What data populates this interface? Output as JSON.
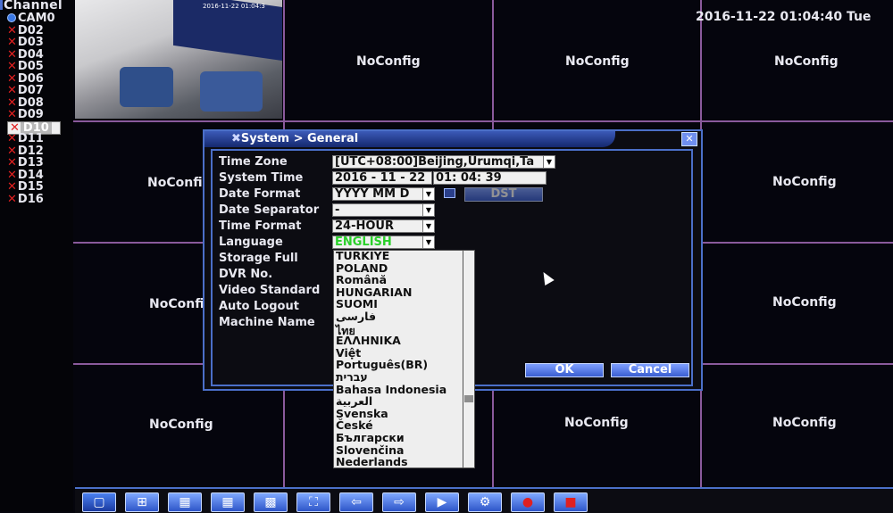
{
  "channel_panel": {
    "header": "Channel",
    "channels": [
      {
        "label": "CAM0",
        "status": "camera"
      },
      {
        "label": "D02",
        "status": "x"
      },
      {
        "label": "D03",
        "status": "x"
      },
      {
        "label": "D04",
        "status": "x"
      },
      {
        "label": "D05",
        "status": "x"
      },
      {
        "label": "D06",
        "status": "x"
      },
      {
        "label": "D07",
        "status": "x"
      },
      {
        "label": "D08",
        "status": "x"
      },
      {
        "label": "D09",
        "status": "x"
      },
      {
        "label": "D10",
        "status": "x",
        "selected": true
      },
      {
        "label": "D11",
        "status": "x"
      },
      {
        "label": "D12",
        "status": "x"
      },
      {
        "label": "D13",
        "status": "x"
      },
      {
        "label": "D14",
        "status": "x"
      },
      {
        "label": "D15",
        "status": "x"
      },
      {
        "label": "D16",
        "status": "x"
      }
    ]
  },
  "datetime": "2016-11-22 01:04:40 Tue",
  "camera_stamp": "2016-11-22 01:04:3",
  "grid": {
    "noconfig_label": "NoConfig",
    "truncated_label": "NoConfi"
  },
  "dialog": {
    "title": "System > General",
    "close_icon": "close-icon",
    "fields": {
      "time_zone": {
        "label": "Time Zone",
        "value": "[UTC+08:00]Beijing,Urumqi,Ta"
      },
      "system_time": {
        "label": "System Time",
        "date": "2016 - 11 - 22",
        "time": "01: 04: 39"
      },
      "date_format": {
        "label": "Date Format",
        "value": "YYYY MM D"
      },
      "date_separator": {
        "label": "Date Separator",
        "value": "-"
      },
      "time_format": {
        "label": "Time Format",
        "value": "24-HOUR"
      },
      "language": {
        "label": "Language",
        "value": "ENGLISH"
      },
      "storage_full": {
        "label": "Storage Full"
      },
      "dvr_no": {
        "label": "DVR No."
      },
      "video_standard": {
        "label": "Video Standard"
      },
      "auto_logout": {
        "label": "Auto Logout"
      },
      "machine_name": {
        "label": "Machine Name"
      }
    },
    "dst_button": "DST",
    "ok_button": "OK",
    "cancel_button": "Cancel"
  },
  "language_options": [
    "TÜRKIYE",
    "POLAND",
    "Română",
    "HUNGARIAN",
    "SUOMI",
    "فارسی",
    "ไทย",
    "ΕΛΛΗΝΙΚΑ",
    "Việt",
    "Português(BR)",
    "עברית",
    "Bahasa Indonesia",
    "العربية",
    "Svenska",
    "České",
    "Български",
    "Slovenčina",
    "Nederlands"
  ],
  "toolbar": {
    "buttons": [
      "single-view-icon",
      "quad-view-icon",
      "eight-view-icon",
      "nine-view-icon",
      "sixteen-view-icon",
      "fullscreen-icon",
      "previous-icon",
      "next-icon",
      "playback-icon",
      "record-config-icon",
      "record-icon",
      "stop-record-icon"
    ]
  }
}
